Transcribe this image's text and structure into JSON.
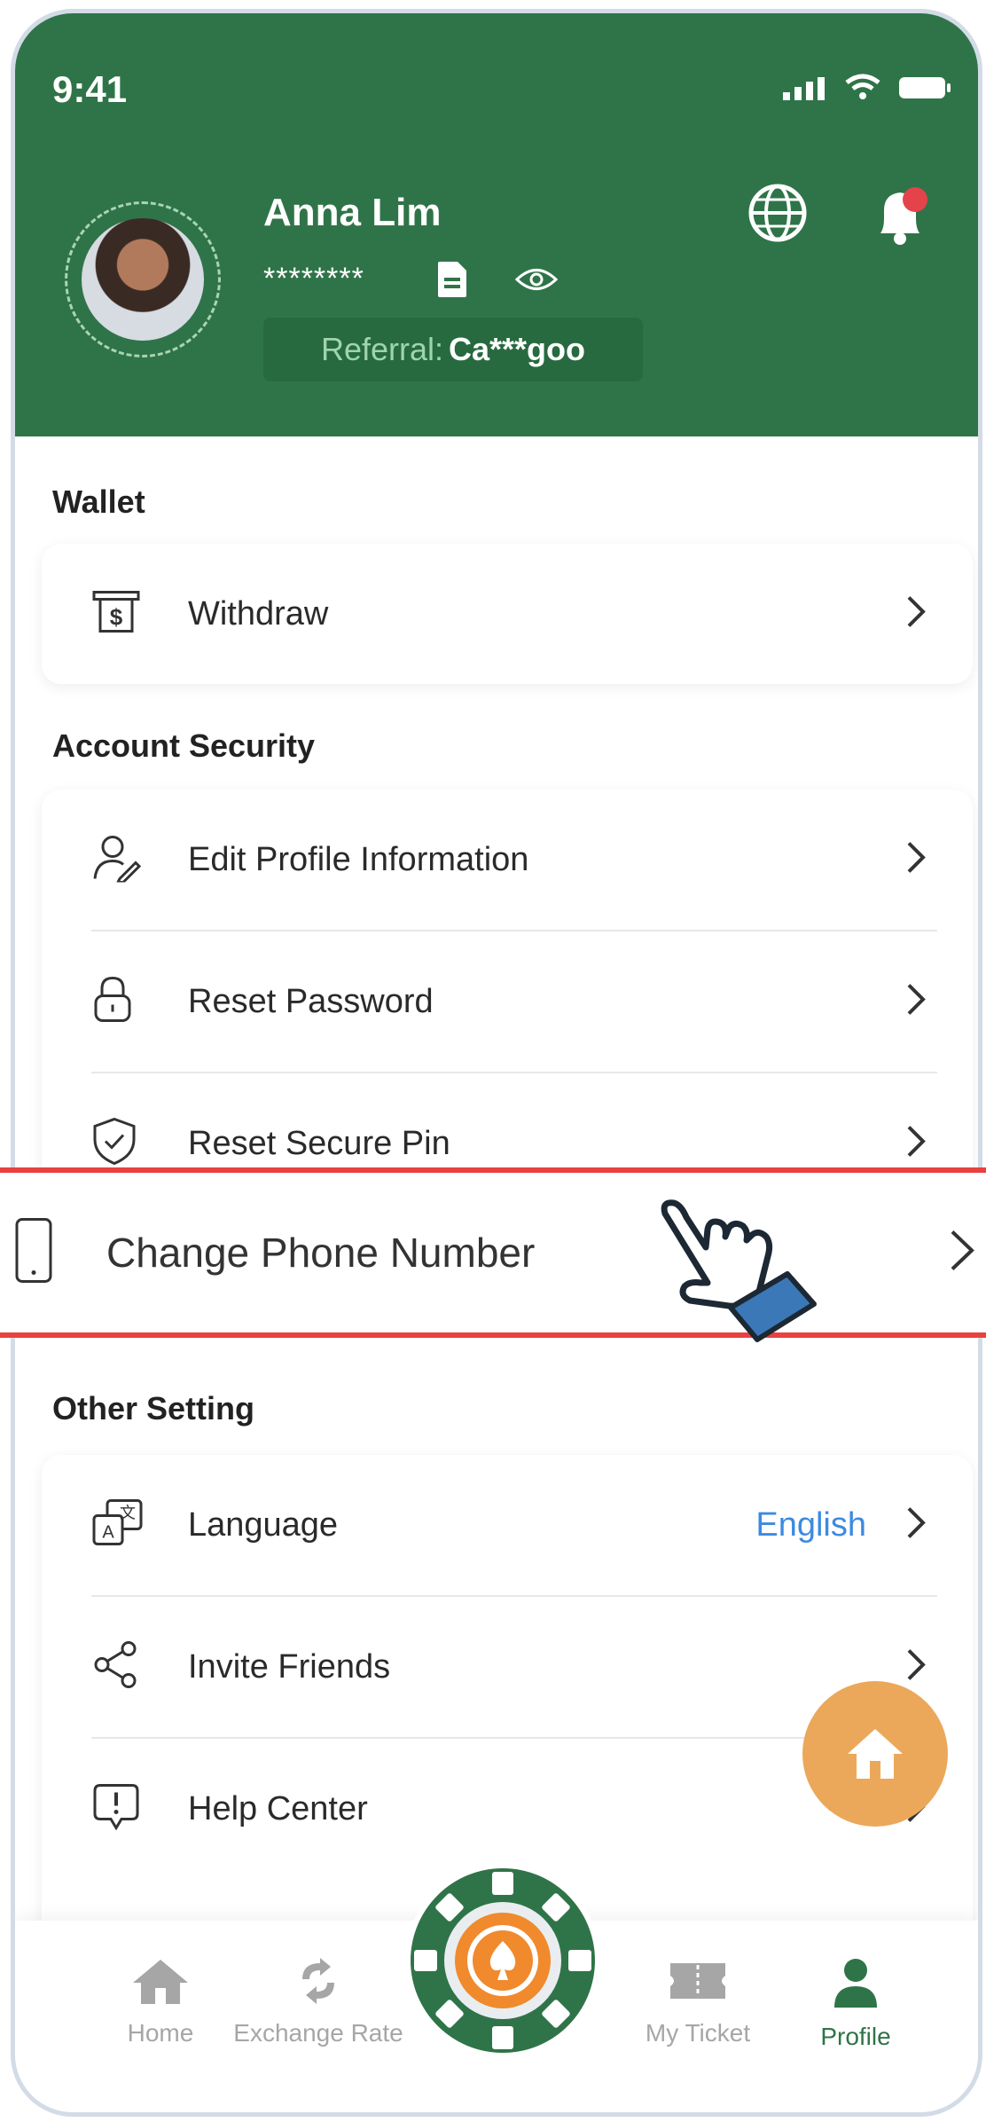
{
  "status_bar": {
    "time": "9:41"
  },
  "profile": {
    "name": "Anna Lim",
    "masked_id": "********",
    "referral_label": "Referral:",
    "referral_code": "Ca***goo"
  },
  "sections": {
    "wallet": {
      "title": "Wallet",
      "items": [
        {
          "label": "Withdraw",
          "icon": "cash-icon"
        }
      ]
    },
    "account_security": {
      "title": "Account Security",
      "items": [
        {
          "label": "Edit Profile Information",
          "icon": "user-edit-icon"
        },
        {
          "label": "Reset Password",
          "icon": "lock-icon"
        },
        {
          "label": "Reset Secure Pin",
          "icon": "shield-check-icon"
        },
        {
          "label": "Change Phone Number",
          "icon": "phone-icon"
        }
      ]
    },
    "other_setting": {
      "title": "Other Setting",
      "items": [
        {
          "label": "Language",
          "value": "English",
          "icon": "translate-icon"
        },
        {
          "label": "Invite Friends",
          "icon": "share-icon"
        },
        {
          "label": "Help Center",
          "icon": "help-icon"
        }
      ]
    }
  },
  "bottom_nav": [
    {
      "label": "Home",
      "icon": "home-icon",
      "active": false
    },
    {
      "label": "Exchange Rate",
      "icon": "exchange-icon",
      "active": false
    },
    {
      "label": "My Ticket",
      "icon": "ticket-icon",
      "active": false
    },
    {
      "label": "Profile",
      "icon": "profile-icon",
      "active": true
    }
  ],
  "colors": {
    "brand_green": "#2f7448",
    "highlight_red": "#e8413f",
    "fab_orange": "#eba85a",
    "link_blue": "#3d8ae0"
  }
}
